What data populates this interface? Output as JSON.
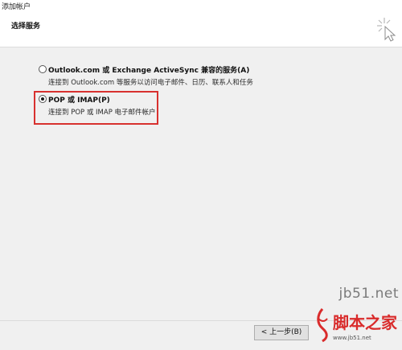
{
  "window": {
    "title": "添加帐户"
  },
  "header": {
    "title": "选择服务",
    "icon": "cursor-sparkle-icon"
  },
  "options": [
    {
      "label": "Outlook.com 或 Exchange ActiveSync 兼容的服务(A)",
      "description": "连接到 Outlook.com 等服务以访问电子邮件、日历、联系人和任务",
      "selected": false
    },
    {
      "label": "POP 或 IMAP(P)",
      "description": "连接到 POP 或 IMAP 电子邮件帐户",
      "selected": true
    }
  ],
  "footer": {
    "back_label": "< 上一步(B)"
  },
  "watermark": {
    "url": "jb51.net",
    "name": "脚本之家",
    "sub": "www.jb51.net"
  },
  "colors": {
    "highlight": "#d8312f",
    "content_bg": "#f0f0f0",
    "watermark_red": "#d92b2b"
  }
}
